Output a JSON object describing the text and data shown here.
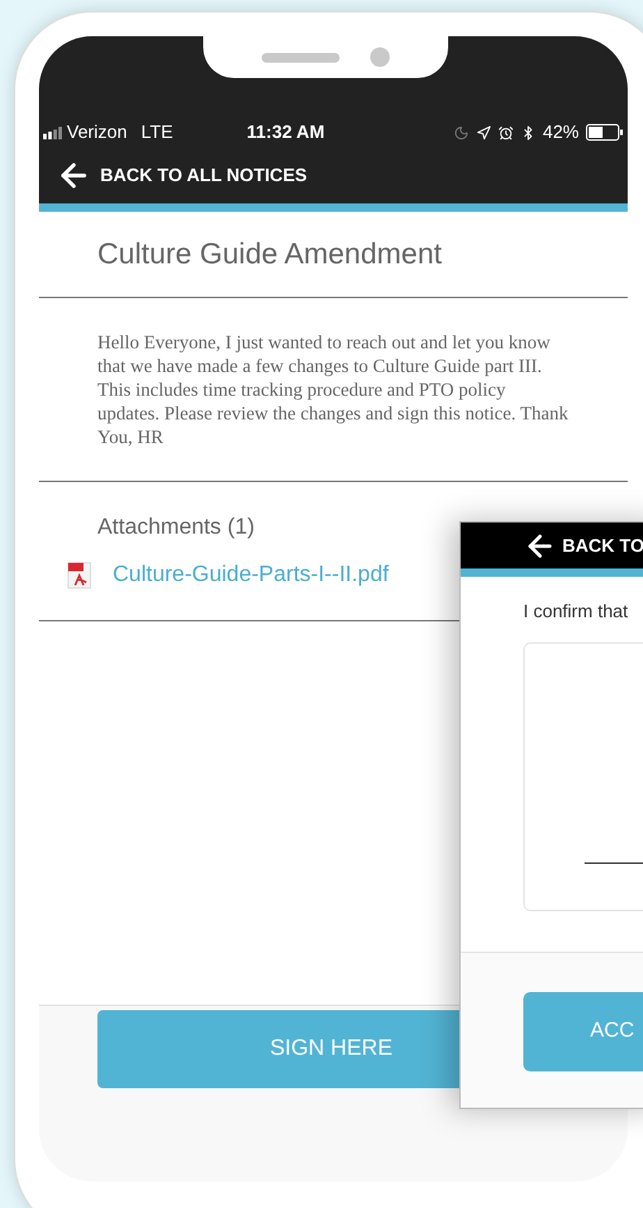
{
  "status_bar": {
    "carrier": "Verizon",
    "network": "LTE",
    "time": "11:32 AM",
    "battery": "42%"
  },
  "nav": {
    "back_label": "BACK TO ALL NOTICES"
  },
  "notice": {
    "title": "Culture Guide Amendment",
    "body": "Hello Everyone, I just wanted to reach out and let you know that we have made a few changes to Culture Guide part III. This includes time tracking procedure and PTO policy updates. Please review the changes and sign this notice. Thank You, HR"
  },
  "attachments": {
    "heading": "Attachments (1)",
    "files": [
      {
        "name": "Culture-Guide-Parts-I--II.pdf"
      }
    ]
  },
  "sign_button": "SIGN HERE",
  "signature_screen": {
    "back_label": "BACK TO",
    "prompt": "I confirm that",
    "accept_button": "ACC"
  }
}
